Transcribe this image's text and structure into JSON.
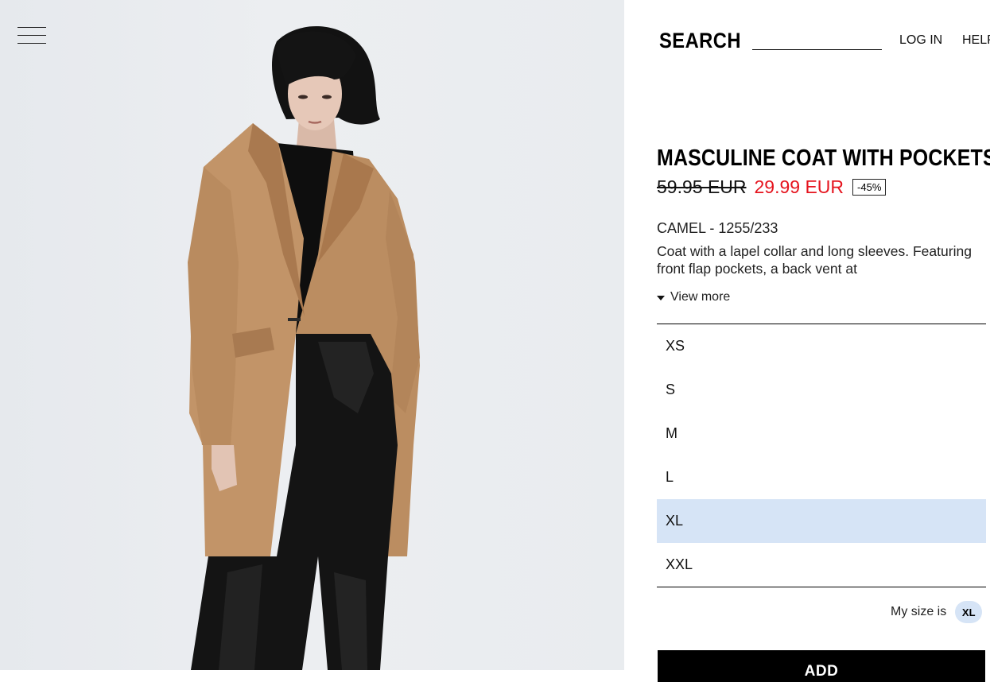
{
  "header": {
    "search_label": "SEARCH",
    "search_placeholder": "",
    "login_label": "LOG IN",
    "help_label": "HELP"
  },
  "product": {
    "title": "MASCULINE COAT WITH POCKETS",
    "old_price": "59.95 EUR",
    "new_price": "29.99 EUR",
    "discount": "-45%",
    "color_ref": "CAMEL - 1255/233",
    "description": "Coat with a lapel collar and long sleeves. Featuring front flap pockets, a back vent at",
    "view_more": "View more"
  },
  "sizes": {
    "options": [
      {
        "label": "XS"
      },
      {
        "label": "S"
      },
      {
        "label": "M"
      },
      {
        "label": "L"
      },
      {
        "label": "XL"
      },
      {
        "label": "XXL"
      }
    ],
    "selected": "XL",
    "my_size_label": "My size is",
    "my_size_value": "XL"
  },
  "actions": {
    "add_label": "ADD"
  },
  "colors": {
    "sale_red": "#e5141e",
    "selected_size_bg": "#d6e4f6",
    "coat_camel": "#c29468"
  },
  "icons": {
    "menu": "hamburger-menu-icon",
    "view_more": "caret-down-icon"
  }
}
